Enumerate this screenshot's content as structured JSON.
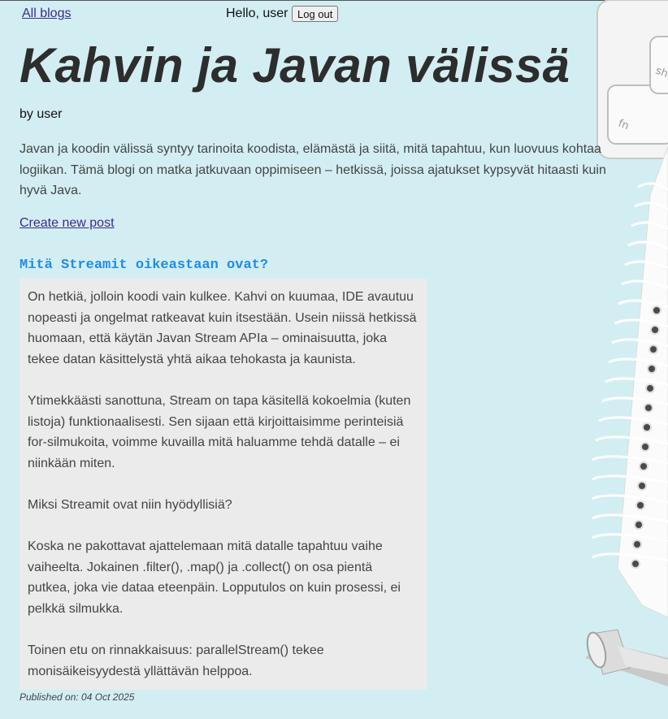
{
  "nav": {
    "all_blogs": "All blogs",
    "hello": "Hello, user",
    "logout": "Log out"
  },
  "blog": {
    "title": "Kahvin ja Javan välissä",
    "author": "by user",
    "description": "Javan ja koodin välissä syntyy tarinoita koodista, elämästä ja siitä, mitä tapahtuu, kun luovuus kohtaa logiikan. Tämä blogi on matka jatkuvaan oppimiseen – hetkissä, joissa ajatukset kypsyvät hitaasti kuin hyvä Java.",
    "create_post": "Create new post"
  },
  "post": {
    "title": "Mitä Streamit oikeastaan ovat?",
    "paragraphs": [
      "On hetkiä, jolloin koodi vain kulkee. Kahvi on kuumaa, IDE avautuu nopeasti ja ongelmat ratkeavat kuin itsestään. Usein niissä hetkissä huomaan, että käytän Javan Stream APIa – ominaisuutta, joka tekee datan käsittelystä yhtä aikaa tehokasta ja kaunista.",
      "Ytimekkäästi sanottuna, Stream on tapa käsitellä kokoelmia (kuten listoja) funktionaalisesti. Sen sijaan että kirjoittaisimme perinteisiä for-silmukoita, voimme kuvailla mitä haluamme tehdä datalle – ei niinkään miten.",
      "Miksi Streamit ovat niin hyödyllisiä?",
      "Koska ne pakottavat ajattelemaan mitä datalle tapahtuu vaihe vaiheelta. Jokainen .filter(), .map() ja .collect() on osa pientä putkea, joka vie dataa eteenpäin. Lopputulos on kuin prosessi, ei pelkkä silmukka.",
      "Toinen etu on rinnakkaisuus: parallelStream() tekee monisäikeisyydestä yllättävän helppoa."
    ],
    "published": "Published on: 04 Oct 2025"
  },
  "background": {
    "color": "#d3eef2",
    "keyboard_keys": [
      "sh",
      "fn"
    ],
    "decor_icons": [
      "keyboard-icon",
      "spiral-notebook-icon",
      "pen-icon"
    ]
  },
  "colors": {
    "link": "#3b2a8f",
    "post_title": "#1e8de8",
    "post_box": "#ebebeb"
  }
}
